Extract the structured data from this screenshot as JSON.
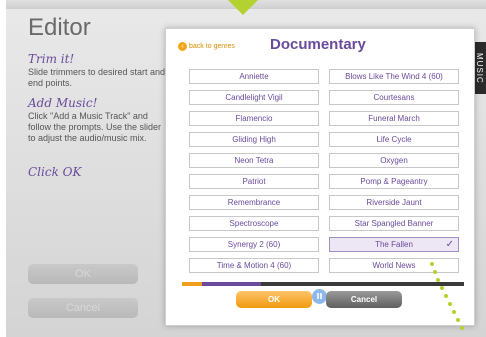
{
  "app": {
    "title": "Editor",
    "accent_color": "#6a4b9b",
    "pointer_color": "#b3d232"
  },
  "sidebar": {
    "trim_heading": "Trim it!",
    "trim_text": "Slide trimmers to desired start and end points.",
    "music_heading": "Add Music!",
    "music_text": "Click \"Add a Music Track\" and follow the prompts. Use the slider to adjust the audio/music mix.",
    "ok_heading": "Click OK",
    "ok_button": "OK",
    "cancel_button": "Cancel"
  },
  "music_tab": {
    "label": "MUSIC"
  },
  "dialog": {
    "back_label": "back to genres",
    "back_icon": "back-arrow-icon",
    "title": "Documentary",
    "songs": [
      {
        "label": "Anniette",
        "selected": false
      },
      {
        "label": "Blows Like The Wind 4 (60)",
        "selected": false
      },
      {
        "label": "Candlelight Vigil",
        "selected": false
      },
      {
        "label": "Courtesans",
        "selected": false
      },
      {
        "label": "Flamencio",
        "selected": false
      },
      {
        "label": "Funeral March",
        "selected": false
      },
      {
        "label": "Gliding High",
        "selected": false
      },
      {
        "label": "Life Cycle",
        "selected": false
      },
      {
        "label": "Neon Tetra",
        "selected": false
      },
      {
        "label": "Oxygen",
        "selected": false
      },
      {
        "label": "Patriot",
        "selected": false
      },
      {
        "label": "Pomp & Pageantry",
        "selected": false
      },
      {
        "label": "Remembrance",
        "selected": false
      },
      {
        "label": "Riverside Jaunt",
        "selected": false
      },
      {
        "label": "Spectroscope",
        "selected": false
      },
      {
        "label": "Star Spangled Banner",
        "selected": false
      },
      {
        "label": "Synergy 2 (60)",
        "selected": false
      },
      {
        "label": "The Fallen",
        "selected": true
      },
      {
        "label": "Time & Motion 4 (60)",
        "selected": false
      },
      {
        "label": "World News",
        "selected": false
      }
    ],
    "check_glyph": "✓",
    "pause_glyph": "II",
    "playback_progress": 0.07,
    "mix_level": 0.28,
    "ok_button": "OK",
    "cancel_button": "Cancel"
  }
}
